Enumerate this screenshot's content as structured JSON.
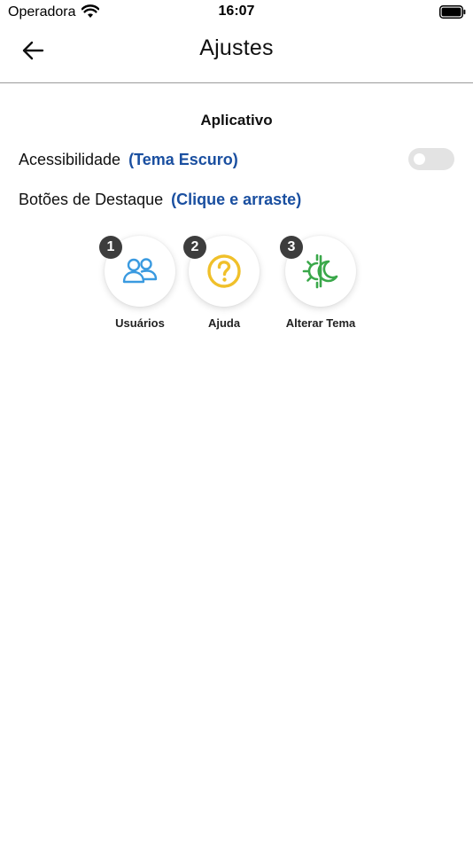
{
  "status_bar": {
    "carrier": "Operadora",
    "time": "16:07"
  },
  "header": {
    "title": "Ajustes"
  },
  "section": {
    "title": "Aplicativo"
  },
  "accessibility": {
    "label": "Acessibilidade",
    "hint": "(Tema Escuro)",
    "toggle_on": false
  },
  "highlight": {
    "label": "Botões de Destaque",
    "hint": "(Clique e arraste)"
  },
  "buttons": [
    {
      "badge": "1",
      "label": "Usuários",
      "icon": "users-icon",
      "color": "#3a9ae0"
    },
    {
      "badge": "2",
      "label": "Ajuda",
      "icon": "help-icon",
      "color": "#f0c02a"
    },
    {
      "badge": "3",
      "label": "Alterar Tema",
      "icon": "theme-icon",
      "color": "#3aa84a"
    }
  ],
  "colors": {
    "accent_link": "#1a4fa0",
    "badge": "#3d3d3d",
    "toggle_off": "#e3e3e3"
  }
}
